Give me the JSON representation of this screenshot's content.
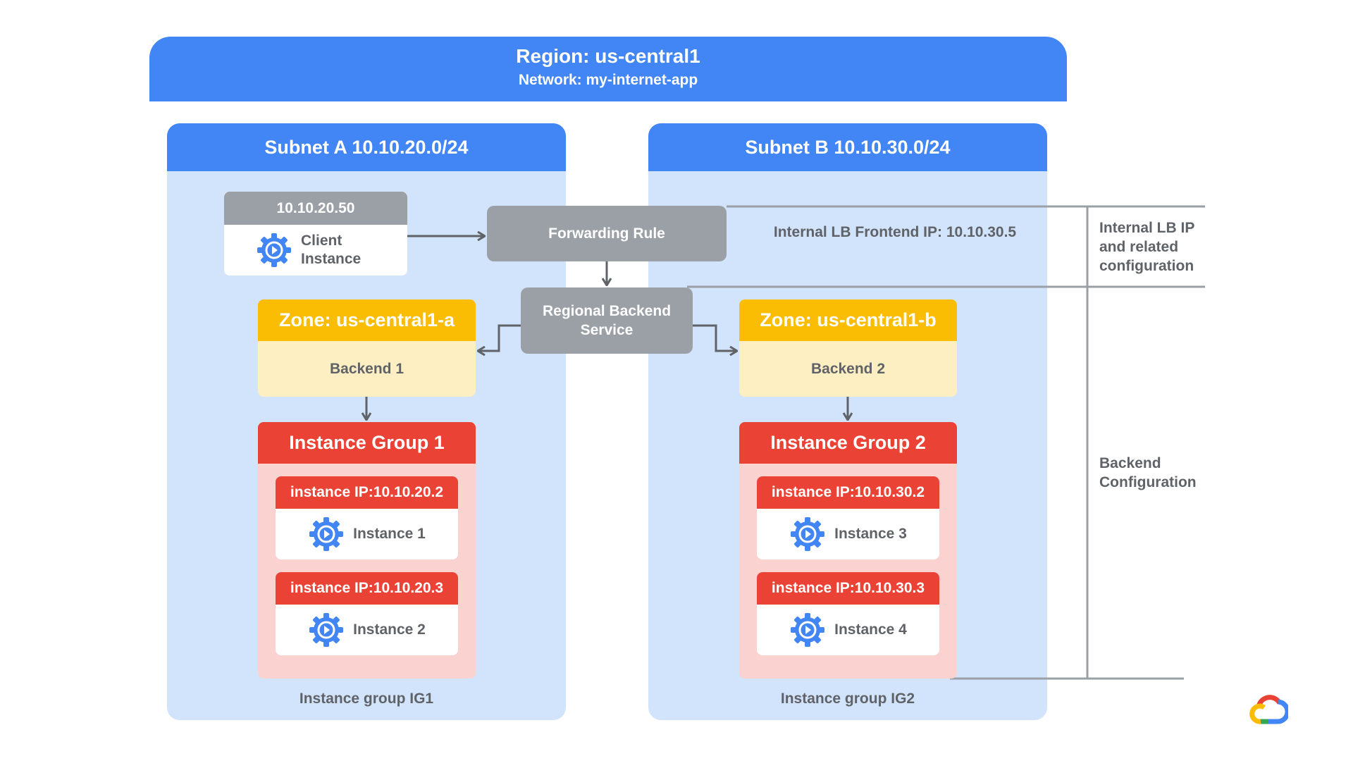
{
  "region": {
    "title": "Region: us-central1",
    "network": "Network: my-internet-app"
  },
  "subnets": [
    {
      "title": "Subnet A 10.10.20.0/24",
      "caption": "Instance group IG1"
    },
    {
      "title": "Subnet B 10.10.30.0/24",
      "caption": "Instance group IG2"
    }
  ],
  "client": {
    "ip": "10.10.20.50",
    "label_line1": "Client",
    "label_line2": "Instance"
  },
  "forwarding_rule": {
    "label": "Forwarding Rule"
  },
  "backend_service": {
    "label_line1": "Regional Backend",
    "label_line2": "Service"
  },
  "frontend_ip": "Internal LB Frontend IP: 10.10.30.5",
  "zones": [
    {
      "title": "Zone: us-central1-a",
      "backend": "Backend 1"
    },
    {
      "title": "Zone: us-central1-b",
      "backend": "Backend 2"
    }
  ],
  "instance_groups": [
    {
      "title": "Instance Group 1",
      "instances": [
        {
          "ip": "instance IP:10.10.20.2",
          "name": "Instance 1"
        },
        {
          "ip": "instance IP:10.10.20.3",
          "name": "Instance 2"
        }
      ]
    },
    {
      "title": "Instance Group 2",
      "instances": [
        {
          "ip": "instance IP:10.10.30.2",
          "name": "Instance 3"
        },
        {
          "ip": "instance IP:10.10.30.3",
          "name": "Instance 4"
        }
      ]
    }
  ],
  "side_labels": {
    "lb_config": [
      "Internal LB IP",
      "and related",
      "configuration"
    ],
    "backend_config": [
      "Backend",
      "Configuration"
    ]
  },
  "icons": {
    "instance": "compute-engine-gear-icon",
    "logo": "google-cloud-logo-icon"
  },
  "colors": {
    "blue": "#4285f4",
    "light_blue": "#d2e3fc",
    "yellow": "#fbbc04",
    "light_yellow": "#feefc3",
    "red": "#ea4335",
    "light_red": "#fad2cf",
    "grey": "#9aa0a6",
    "text_grey": "#5f6368"
  }
}
